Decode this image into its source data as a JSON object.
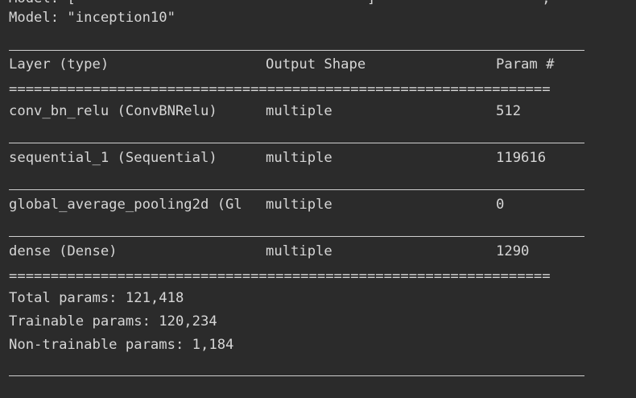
{
  "header": {
    "cutoff_text": "Model: [                                   ]                    , ",
    "model_line": "Model: \"inception10\""
  },
  "table": {
    "headers": [
      "Layer (type)",
      "Output Shape",
      "Param #"
    ],
    "separator": "=================================================================",
    "rows": [
      {
        "layer": "conv_bn_relu (ConvBNRelu)",
        "shape": "multiple",
        "params": "512"
      },
      {
        "layer": "sequential_1 (Sequential)",
        "shape": "multiple",
        "params": "119616"
      },
      {
        "layer": "global_average_pooling2d (Gl",
        "shape": "multiple",
        "params": "0"
      },
      {
        "layer": "dense (Dense)",
        "shape": "multiple",
        "params": "1290"
      }
    ]
  },
  "summary": {
    "total": "Total params: 121,418",
    "trainable": "Trainable params: 120,234",
    "non_trainable": "Non-trainable params: 1,184"
  }
}
